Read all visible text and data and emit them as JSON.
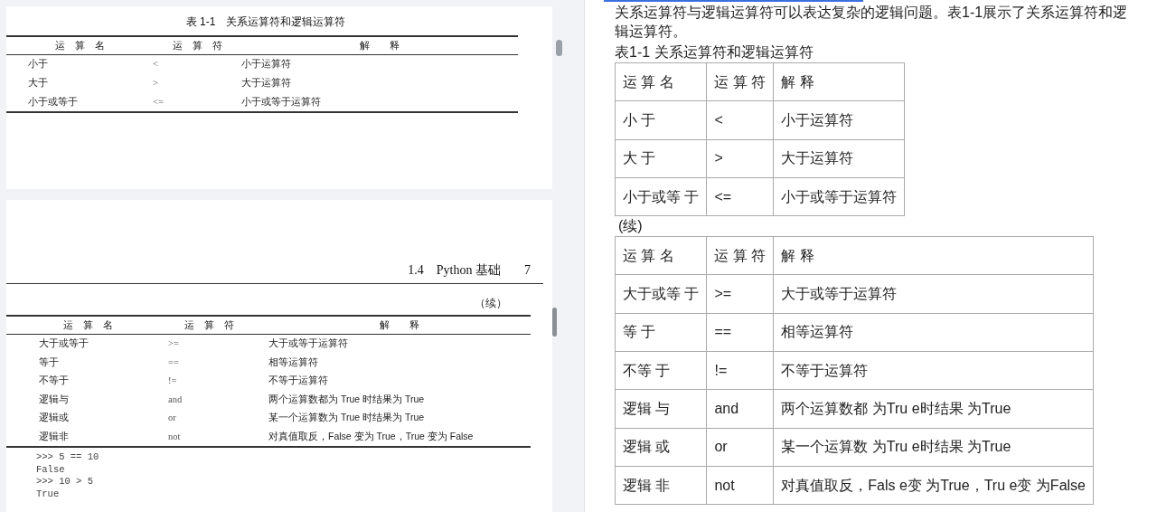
{
  "left_pane": {
    "page_1": {
      "table_title": "表 1-1　关系运算符和逻辑运算符",
      "columns": [
        "运　算　名",
        "运　算　符",
        "解　　释"
      ],
      "rows": [
        [
          "小于",
          "<",
          "小于运算符"
        ],
        [
          "大于",
          ">",
          "大于运算符"
        ],
        [
          "小于或等于",
          "<=",
          "小于或等于运算符"
        ]
      ]
    },
    "page_2": {
      "running_header": "1.4　Python 基础",
      "page_number": "7",
      "continued_label": "（续）",
      "columns": [
        "运　算　名",
        "运　算　符",
        "解　　释"
      ],
      "rows": [
        [
          "大于或等于",
          ">=",
          "大于或等于运算符"
        ],
        [
          "等于",
          "==",
          "相等运算符"
        ],
        [
          "不等于",
          "!=",
          "不等于运算符"
        ],
        [
          "逻辑与",
          "and",
          "两个运算数都为 True 时结果为 True"
        ],
        [
          "逻辑或",
          "or",
          "某一个运算数为 True 时结果为 True"
        ],
        [
          "逻辑非",
          "not",
          "对真值取反，False 变为 True，True 变为 False"
        ]
      ],
      "code_lines": [
        ">>> 5 == 10",
        "False",
        ">>> 10 > 5",
        "True"
      ]
    }
  },
  "right_pane": {
    "paragraph": "关系运算符与逻辑运算符可以表达复杂的逻辑问题。表1-1展示了关系运算符和逻辑运算符。",
    "table_title": "表1-1 关系运算符和逻辑运算符",
    "table_1": {
      "columns": [
        "运 算 名",
        "运 算 符",
        "解 释"
      ],
      "rows": [
        [
          "小 于",
          "<",
          "小于运算符"
        ],
        [
          "大 于",
          ">",
          "大于运算符"
        ],
        [
          "小于或等 于",
          "<=",
          "小于或等于运算符"
        ]
      ]
    },
    "continued_label": "(续)",
    "table_2": {
      "columns": [
        "运 算 名",
        "运 算 符",
        "解 释"
      ],
      "rows": [
        [
          "大于或等 于",
          ">=",
          "大于或等于运算符"
        ],
        [
          "等 于",
          "==",
          "相等运算符"
        ],
        [
          "不等 于",
          "!=",
          "不等于运算符"
        ],
        [
          "逻辑 与",
          "and",
          "两个运算数都 为Tru e时结果 为True"
        ],
        [
          "逻辑 或",
          "or",
          "某一个运算数 为Tru e时结果 为True"
        ],
        [
          "逻辑 非",
          "not",
          "对真值取反，Fals e变 为True，Tru e变 为False"
        ]
      ]
    }
  }
}
